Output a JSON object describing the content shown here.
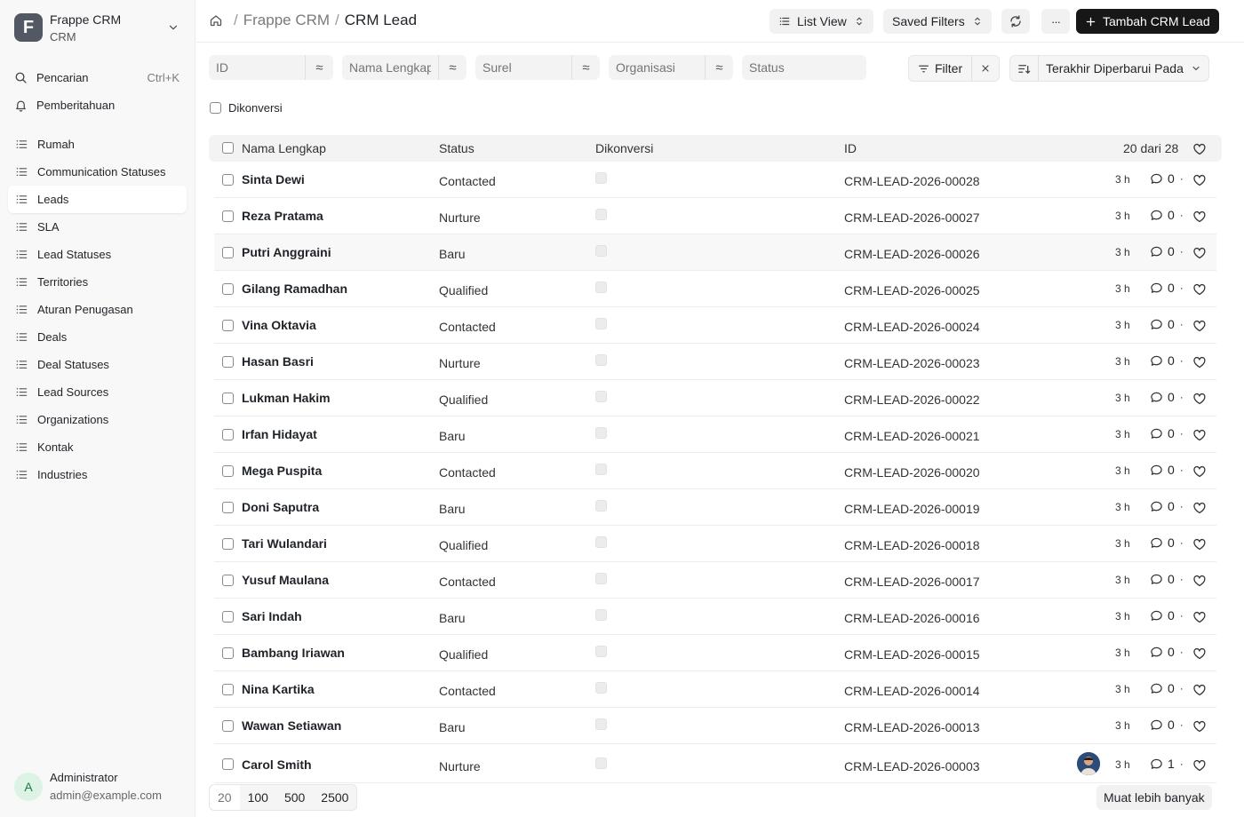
{
  "brand": {
    "logo_letter": "F",
    "title": "Frappe CRM",
    "subtitle": "CRM"
  },
  "nav_top": [
    {
      "label": "Pencarian",
      "shortcut": "Ctrl+K"
    },
    {
      "label": "Pemberitahuan"
    }
  ],
  "nav_items": [
    {
      "label": "Rumah"
    },
    {
      "label": "Communication Statuses"
    },
    {
      "label": "Leads"
    },
    {
      "label": "SLA"
    },
    {
      "label": "Lead Statuses"
    },
    {
      "label": "Territories"
    },
    {
      "label": "Aturan Penugasan"
    },
    {
      "label": "Deals"
    },
    {
      "label": "Deal Statuses"
    },
    {
      "label": "Lead Sources"
    },
    {
      "label": "Organizations"
    },
    {
      "label": "Kontak"
    },
    {
      "label": "Industries"
    }
  ],
  "active_nav": "Leads",
  "user": {
    "initial": "A",
    "name": "Administrator",
    "email": "admin@example.com"
  },
  "breadcrumb": {
    "sep": "/",
    "app": "Frappe CRM",
    "current": "CRM Lead"
  },
  "toolbar": {
    "list_view": "List View",
    "saved_filters": "Saved Filters",
    "more": "···",
    "add_button": "Tambah CRM Lead"
  },
  "filters": {
    "id_placeholder": "ID",
    "name_placeholder": "Nama Lengkap",
    "email_placeholder": "Surel",
    "org_placeholder": "Organisasi",
    "status_placeholder": "Status",
    "op_symbol": "≈",
    "filter_label": "Filter",
    "sort_label": "Terakhir Diperbarui Pada",
    "converted_label": "Dikonversi"
  },
  "table": {
    "columns": {
      "name": "Nama Lengkap",
      "status": "Status",
      "converted": "Dikonversi",
      "id": "ID",
      "count": "20 dari 28"
    },
    "rows": [
      {
        "name": "Sinta Dewi",
        "status": "Contacted",
        "id": "CRM-LEAD-2026-00028",
        "time": "3 h",
        "comments": "0"
      },
      {
        "name": "Reza Pratama",
        "status": "Nurture",
        "id": "CRM-LEAD-2026-00027",
        "time": "3 h",
        "comments": "0"
      },
      {
        "name": "Putri Anggraini",
        "status": "Baru",
        "id": "CRM-LEAD-2026-00026",
        "time": "3 h",
        "comments": "0"
      },
      {
        "name": "Gilang Ramadhan",
        "status": "Qualified",
        "id": "CRM-LEAD-2026-00025",
        "time": "3 h",
        "comments": "0"
      },
      {
        "name": "Vina Oktavia",
        "status": "Contacted",
        "id": "CRM-LEAD-2026-00024",
        "time": "3 h",
        "comments": "0"
      },
      {
        "name": "Hasan Basri",
        "status": "Nurture",
        "id": "CRM-LEAD-2026-00023",
        "time": "3 h",
        "comments": "0"
      },
      {
        "name": "Lukman Hakim",
        "status": "Qualified",
        "id": "CRM-LEAD-2026-00022",
        "time": "3 h",
        "comments": "0"
      },
      {
        "name": "Irfan Hidayat",
        "status": "Baru",
        "id": "CRM-LEAD-2026-00021",
        "time": "3 h",
        "comments": "0"
      },
      {
        "name": "Mega Puspita",
        "status": "Contacted",
        "id": "CRM-LEAD-2026-00020",
        "time": "3 h",
        "comments": "0"
      },
      {
        "name": "Doni Saputra",
        "status": "Baru",
        "id": "CRM-LEAD-2026-00019",
        "time": "3 h",
        "comments": "0"
      },
      {
        "name": "Tari Wulandari",
        "status": "Qualified",
        "id": "CRM-LEAD-2026-00018",
        "time": "3 h",
        "comments": "0"
      },
      {
        "name": "Yusuf Maulana",
        "status": "Contacted",
        "id": "CRM-LEAD-2026-00017",
        "time": "3 h",
        "comments": "0"
      },
      {
        "name": "Sari Indah",
        "status": "Baru",
        "id": "CRM-LEAD-2026-00016",
        "time": "3 h",
        "comments": "0"
      },
      {
        "name": "Bambang Iriawan",
        "status": "Qualified",
        "id": "CRM-LEAD-2026-00015",
        "time": "3 h",
        "comments": "0"
      },
      {
        "name": "Nina Kartika",
        "status": "Contacted",
        "id": "CRM-LEAD-2026-00014",
        "time": "3 h",
        "comments": "0"
      },
      {
        "name": "Wawan Setiawan",
        "status": "Baru",
        "id": "CRM-LEAD-2026-00013",
        "time": "3 h",
        "comments": "0"
      },
      {
        "name": "Carol Smith",
        "status": "Nurture",
        "id": "CRM-LEAD-2026-00003",
        "time": "3 h",
        "comments": "1",
        "has_avatar": true
      }
    ]
  },
  "pager": {
    "options": [
      "20",
      "100",
      "500",
      "2500"
    ],
    "selected": "20"
  },
  "load_more": "Muat lebih banyak"
}
